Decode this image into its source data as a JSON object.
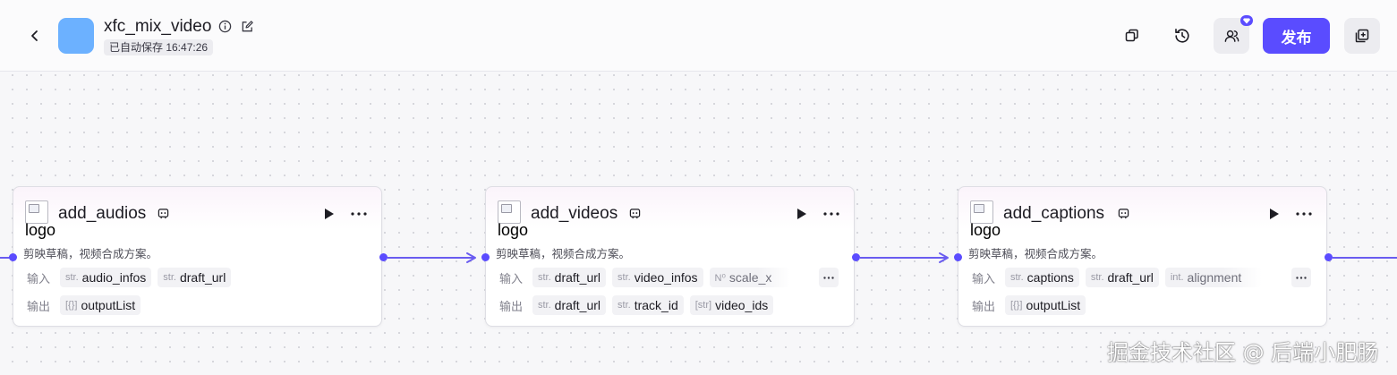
{
  "header": {
    "title": "xfc_mix_video",
    "saved_status": "已自动保存 16:47:26",
    "publish_label": "发布"
  },
  "colors": {
    "accent": "#5a4cff",
    "app_icon": "#6cb1ff",
    "edge": "#6a5cf0"
  },
  "nodes": [
    {
      "title": "add_audios",
      "logo_alt": "logo",
      "description": "剪映草稿，视频合成方案。",
      "input_label": "输入",
      "output_label": "输出",
      "inputs": [
        {
          "type": "str.",
          "name": "audio_infos"
        },
        {
          "type": "str.",
          "name": "draft_url"
        }
      ],
      "outputs": [
        {
          "type": "[{}]",
          "name": "outputList"
        }
      ]
    },
    {
      "title": "add_videos",
      "logo_alt": "logo",
      "description": "剪映草稿，视频合成方案。",
      "input_label": "输入",
      "output_label": "输出",
      "inputs": [
        {
          "type": "str.",
          "name": "draft_url"
        },
        {
          "type": "str.",
          "name": "video_infos"
        },
        {
          "type": "N⁰",
          "name": "scale_x"
        }
      ],
      "outputs": [
        {
          "type": "str.",
          "name": "draft_url"
        },
        {
          "type": "str.",
          "name": "track_id"
        },
        {
          "type": "[str]",
          "name": "video_ids"
        }
      ]
    },
    {
      "title": "add_captions",
      "logo_alt": "logo",
      "description": "剪映草稿，视频合成方案。",
      "input_label": "输入",
      "output_label": "输出",
      "inputs": [
        {
          "type": "str.",
          "name": "captions"
        },
        {
          "type": "str.",
          "name": "draft_url"
        },
        {
          "type": "int.",
          "name": "alignment"
        }
      ],
      "outputs": [
        {
          "type": "[{}]",
          "name": "outputList"
        }
      ]
    }
  ],
  "watermark": "掘金技术社区 @ 后端小肥肠"
}
